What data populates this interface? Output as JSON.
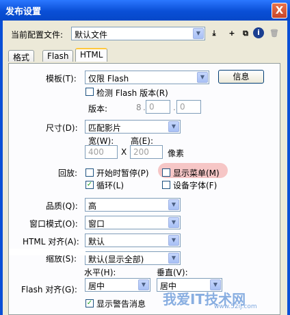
{
  "window": {
    "title": "发布设置",
    "close": "X"
  },
  "profile": {
    "label": "当前配置文件:",
    "value": "默认文件",
    "buttons": [
      {
        "name": "import-export-button",
        "glyph": "⤓"
      },
      {
        "name": "add-profile-button",
        "glyph": "+"
      },
      {
        "name": "duplicate-profile-button",
        "glyph": "⧉"
      },
      {
        "name": "profile-info-button",
        "glyph": "i"
      },
      {
        "name": "delete-profile-button",
        "glyph": "🗑"
      }
    ]
  },
  "tabs": [
    {
      "label": "格式",
      "active": false
    },
    {
      "label": "Flash",
      "active": false
    },
    {
      "label": "HTML",
      "active": true
    }
  ],
  "html": {
    "template_label": "模板(T):",
    "template_value": "仅限 Flash",
    "info_button": "信息",
    "detect_version": "检测 Flash 版本(R)",
    "version_label": "版本:",
    "version": [
      "8",
      "0",
      "0"
    ],
    "dimensions_label": "尺寸(D):",
    "dimensions_value": "匹配影片",
    "width_label": "宽(W):",
    "height_label": "高(E):",
    "width": "400",
    "x": "X",
    "height": "200",
    "units": "像素",
    "playback_label": "回放:",
    "pause_start": "开始时暂停(P)",
    "show_menu": "显示菜单(M)",
    "loop": "循环(L)",
    "device_font": "设备字体(F)",
    "quality_label": "品质(Q):",
    "quality_value": "高",
    "window_mode_label": "窗口模式(O):",
    "window_mode_value": "窗口",
    "html_align_label": "HTML 对齐(A):",
    "html_align_value": "默认",
    "scale_label": "缩放(S):",
    "scale_value": "默认(显示全部)",
    "h_label": "水平(H):",
    "v_label": "垂直(V):",
    "flash_align_label": "Flash 对齐(G):",
    "h_value": "居中",
    "v_value": "居中",
    "warnings": "显示警告消息",
    "watermark": "我爱IT技术网",
    "watermark_url": "www.52ij.com"
  }
}
